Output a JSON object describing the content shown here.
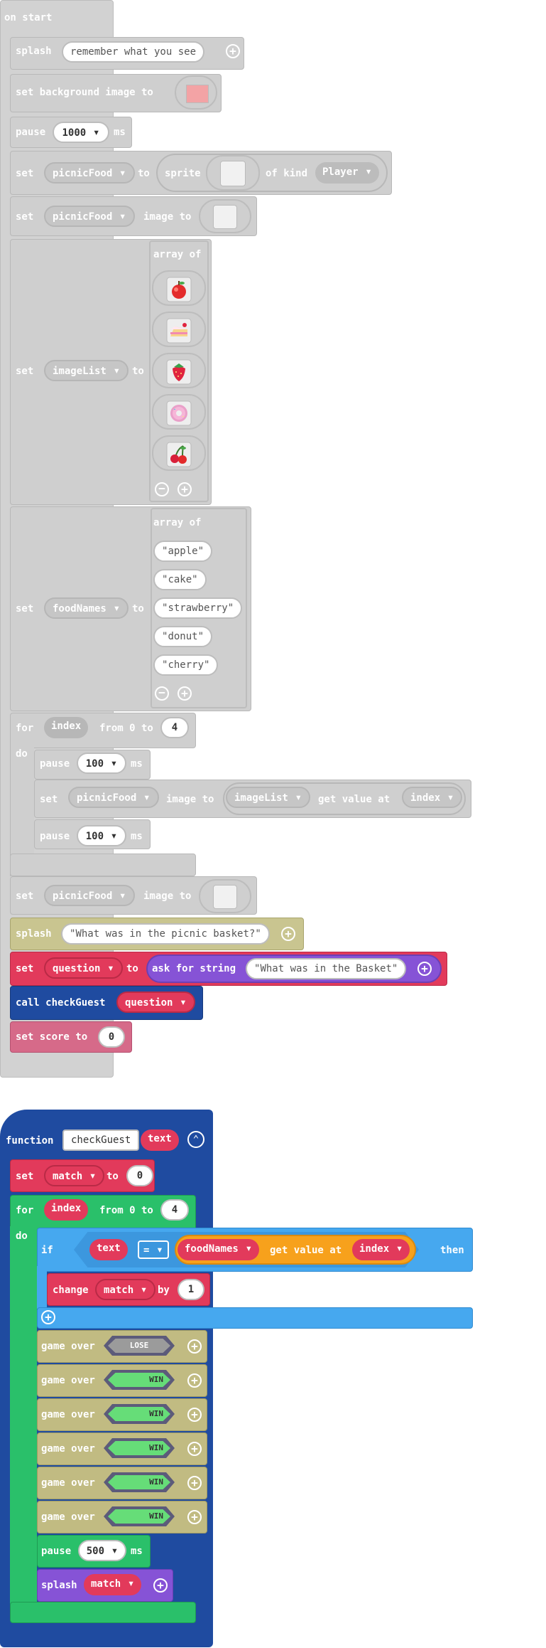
{
  "on_start": {
    "header": "on start",
    "splash_label": "splash",
    "splash_text": "remember what you see",
    "set_bg_label": "set background image to",
    "pause_label": "pause",
    "pause_value": "1000",
    "ms": "ms",
    "set": "set",
    "to": "to",
    "image_to": "image to",
    "var_picnicFood": "picnicFood",
    "sprite": "sprite",
    "of_kind": "of kind",
    "kind_player": "Player",
    "var_imageList": "imageList",
    "array_of": "array of",
    "food_images": [
      "apple-icon",
      "cake-icon",
      "strawberry-icon",
      "donut-icon",
      "cherry-icon"
    ],
    "var_foodNames": "foodNames",
    "food_names": [
      "apple",
      "cake",
      "strawberry",
      "donut",
      "cherry"
    ],
    "for": "for",
    "do": "do",
    "var_index": "index",
    "from_0_to": "from 0 to",
    "loop_max": "4",
    "pause_100": "100",
    "get_value_at": "get value at",
    "splash2_text": "What was in the picnic basket?",
    "var_question": "question",
    "ask_for_string": "ask for string",
    "ask_text": "What was in the Basket",
    "call_checkGuest": "call checkGuest",
    "set_score_to": "set score to",
    "score_value": "0"
  },
  "function": {
    "keyword": "function",
    "name": "checkGuest",
    "param": "text",
    "set": "set",
    "var_match": "match",
    "to": "to",
    "match_init": "0",
    "for": "for",
    "do": "do",
    "var_index": "index",
    "from_0_to": "from 0 to",
    "loop_max": "4",
    "if": "if",
    "then": "then",
    "param_text": "text",
    "op_equals": "=",
    "var_foodNames": "foodNames",
    "get_value_at": "get value at",
    "change": "change",
    "by": "by",
    "change_by": "1",
    "game_over": "game over",
    "results": [
      "LOSE",
      "WIN",
      "WIN",
      "WIN",
      "WIN",
      "WIN"
    ],
    "pause": "pause",
    "pause_value": "500",
    "ms": "ms",
    "splash": "splash"
  },
  "colors": {
    "disabled_grey": "#cfcfcf",
    "splash_olive": "#c8c48c",
    "variables_red": "#e23a5b",
    "text_purple": "#8653d6",
    "functions_blue": "#1f4ba0",
    "score_pink": "#d66a89",
    "loops_green": "#2ac06a",
    "logic_blue": "#46a8ef",
    "array_orange": "#f7a11c",
    "game_over_olive": "#c1bb82"
  }
}
